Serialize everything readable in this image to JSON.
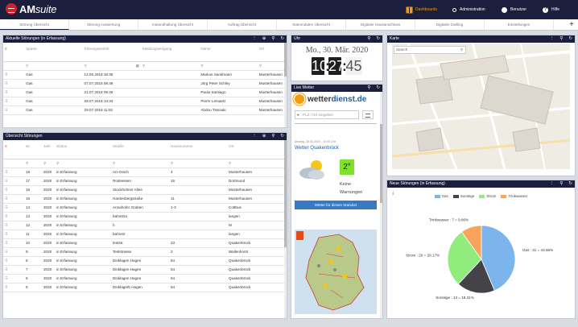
{
  "app": {
    "brand_main": "AM",
    "brand_sub": "suite"
  },
  "nav": [
    {
      "label": "Dashboards",
      "icon": "dashboard-icon",
      "active": true
    },
    {
      "label": "Administration",
      "icon": "key-icon"
    },
    {
      "label": "Benutzer",
      "icon": "user-icon"
    },
    {
      "label": "Hilfe",
      "icon": "help-icon"
    }
  ],
  "tabs": [
    "Störung Übersicht",
    "Störung Auswertung",
    "Instandhaltung Übersicht",
    "Auftrag Übersicht",
    "Stammdaten Übersicht",
    "Digitaler Hausanschluss",
    "Digitaler Zwilling",
    "Einstellungen"
  ],
  "panel_current": {
    "title": "Aktuelle Störungen (in Erfassung)",
    "columns": [
      "Sparte",
      "Störungseintritt",
      "Meldungseingang",
      "Name",
      "Ort"
    ],
    "rows": [
      [
        "Gas",
        "12.06.2018 18:35",
        "",
        "Markus Sandmann",
        "Musterhausen"
      ],
      [
        "Gas",
        "07.07.2018 08:48",
        "",
        "Jörg Peter Schley",
        "Musterhausen"
      ],
      [
        "Gas",
        "21.07.2018 09:46",
        "",
        "Paula Santiago",
        "Musterhausen"
      ],
      [
        "Gas",
        "28.07.2018 13:34",
        "",
        "Pierre Lemaetz",
        "Musterhausen"
      ],
      [
        "Gas",
        "29.07.2018 11:02",
        "",
        "Abdou Tissouki",
        "Musterhausen"
      ]
    ]
  },
  "panel_overview": {
    "title": "Übersicht Störungen",
    "columns": [
      "Nr.",
      "Jahr",
      "Status",
      "Straße",
      "Hausnummer",
      "Ort"
    ],
    "rows": [
      [
        "18",
        "2020",
        "in Erfassung",
        "Am Deich",
        "4",
        "Musterhausen"
      ],
      [
        "17",
        "2020",
        "in Erfassung",
        "Rosteeisen",
        "15",
        "Dortmund"
      ],
      [
        "16",
        "2020",
        "in Erfassung",
        "Stockholmer Allee",
        "",
        "Musterhausen"
      ],
      [
        "15",
        "2020",
        "in Erfassung",
        "Hardenbergstraße",
        "11",
        "Musterhausen"
      ],
      [
        "14",
        "2020",
        "in Erfassung",
        "Annahofer Graben",
        "1-3",
        "Cottbus"
      ],
      [
        "13",
        "2020",
        "in Erfassung",
        "bahnstra",
        "",
        "langen"
      ],
      [
        "12",
        "2020",
        "in Erfassung",
        "h",
        "",
        "M"
      ],
      [
        "11",
        "2020",
        "in Erfassung",
        "bahnstr",
        "",
        "langen"
      ],
      [
        "10",
        "2020",
        "in Erfassung",
        "teststr.",
        "23",
        "Quakenbrück"
      ],
      [
        "9",
        "2020",
        "in Erfassung",
        "Teststrasse",
        "2",
        "Wallenhorst"
      ],
      [
        "8",
        "2020",
        "in Erfassung",
        "Dinklagen Hagen",
        "54",
        "Quakenbrück"
      ],
      [
        "7",
        "2020",
        "in Erfassung",
        "Dinklagen Hagen",
        "54",
        "Quakenbrück"
      ],
      [
        "6",
        "2020",
        "in Erfassung",
        "Dinklagen Hagen",
        "54",
        "Quakenbrück"
      ],
      [
        "5",
        "2020",
        "in Erfassung",
        "Dinklagerb Hagen",
        "54",
        "Quakenbrück"
      ]
    ]
  },
  "clock": {
    "title": "Uhr",
    "date": "Mo., 30. Mär. 2020",
    "hour": "10",
    "minute": "27",
    "second": "45"
  },
  "weather": {
    "title": "Live Wetter",
    "logo_a": "wetter",
    "logo_b": "dienst.de",
    "placeholder": "PLZ / Ort eingeben",
    "timestamp": "Montag, 30.03.2020 - 10:00 Uhr",
    "location": "Wetter Quakenbrück",
    "temp": "2°",
    "desc": "Keine Warnungen",
    "button": "Wetter für diesen Standort"
  },
  "map": {
    "title": "Karte",
    "search": "Search"
  },
  "pie_panel": {
    "title": "Neue Störungen (in Erfassung)"
  },
  "chart_data": {
    "type": "pie",
    "title": "",
    "series": [
      {
        "name": "Gas",
        "label": "Gas : 31 = 43.66%",
        "value": 31,
        "color": "#7cb5ec"
      },
      {
        "name": "Sonstige",
        "label": "Sonstige : 13 = 18.31%",
        "value": 13,
        "color": "#434348"
      },
      {
        "name": "Strom",
        "label": "Strom : 20 = 28.17%",
        "value": 20,
        "color": "#90ed7d"
      },
      {
        "name": "Trinkwasser",
        "label": "Trinkwasser : 7 = 9.86%",
        "value": 7,
        "color": "#f7a35c"
      }
    ],
    "legend": "top"
  }
}
